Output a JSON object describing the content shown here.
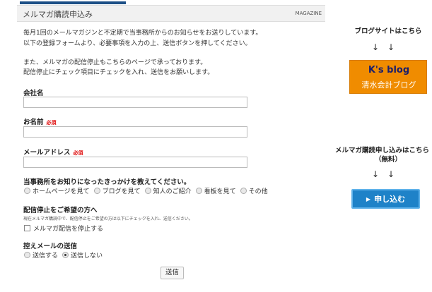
{
  "header": {
    "title": "メルマガ購読申込み",
    "tag": "MAGAZINE"
  },
  "intro": {
    "lines": [
      "毎月1回のメールマガジンと不定期で当事務所からのお知らせをお送りしています。",
      "以下の登録フォームより、必要事項を入力の上、送信ボタンを押してください。",
      "また、メルマガの配信停止もこちらのページで承っております。",
      "配信停止にチェック項目にチェックを入れ、送信をお願いします。"
    ]
  },
  "form": {
    "company_label": "会社名",
    "name_label": "お名前",
    "email_label": "メールアドレス",
    "required_mark": "必須",
    "source_label": "当事務所をお知りになったきっかけを教えてください。",
    "source_options": [
      "ホームページを見て",
      "ブログを見て",
      "知人のご紹介",
      "看板を見て",
      "その他"
    ],
    "unsub_label": "配信停止をご希望の方へ",
    "unsub_note": "現在メルマガ購読中で、配信停止をご希望の方は以下にチェックを入れ、送信ください。",
    "unsub_checkbox": "メルマガ配信を停止する",
    "copy_label": "控えメールの送信",
    "copy_options": [
      "送信する",
      "送信しない"
    ],
    "copy_selected": "送信しない",
    "submit_label": "送信"
  },
  "sidebar": {
    "blog_heading": "ブログサイトはこちら",
    "arrows": "↓　↓",
    "blog_title": "K's blog",
    "blog_subtitle": "清水会計ブログ",
    "subscribe_heading": "メルマガ購読申し込みはこちら",
    "subscribe_free": "（無料）",
    "apply_label": "申し込む"
  },
  "colors": {
    "header_accent": "#1c4f86",
    "blog_orange": "#f08c00",
    "blog_title": "#1a1f6b",
    "apply_blue": "#1e82c8",
    "required_red": "#dd0000"
  }
}
